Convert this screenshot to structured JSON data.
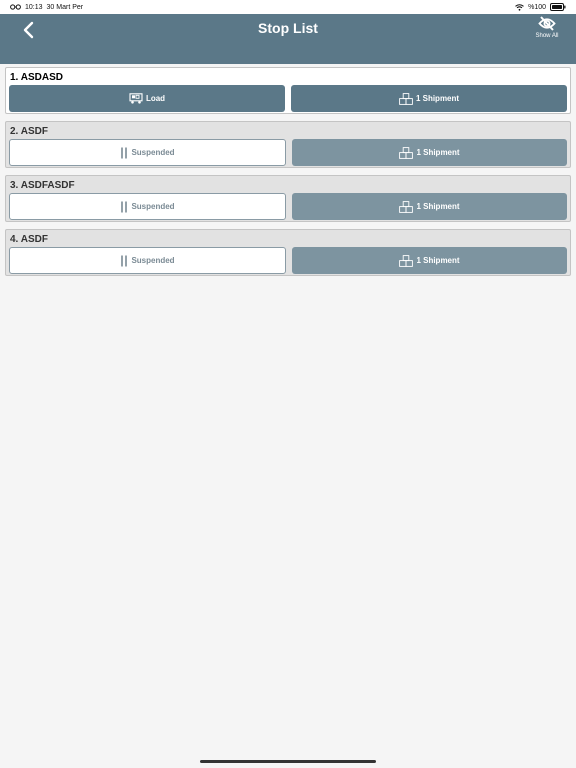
{
  "status_bar": {
    "time": "10:13",
    "date": "30 Mart Per",
    "battery": "%100"
  },
  "nav": {
    "title": "Stop List",
    "show_all_label": "Show All"
  },
  "stops": [
    {
      "title": "1. ASDASD",
      "primary_label": "Load",
      "shipment_label": "1 Shipment"
    },
    {
      "title": "2. ASDF",
      "primary_label": "Suspended",
      "shipment_label": "1 Shipment"
    },
    {
      "title": "3. ASDFASDF",
      "primary_label": "Suspended",
      "shipment_label": "1 Shipment"
    },
    {
      "title": "4. ASDF",
      "primary_label": "Suspended",
      "shipment_label": "1 Shipment"
    }
  ],
  "colors": {
    "header": "#5b7888",
    "button_primary": "#5b7888",
    "button_dim": "#7d94a0",
    "background": "#f5f5f5"
  },
  "icons": {
    "back": "chevron-left-icon",
    "show_all": "eye-off-icon",
    "load": "truck-load-icon",
    "suspended": "pause-icon",
    "shipment": "boxes-icon"
  }
}
